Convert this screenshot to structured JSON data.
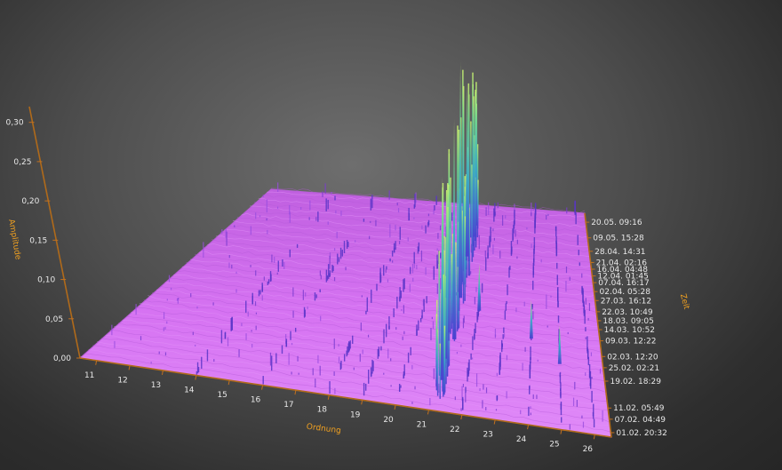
{
  "chart_data": {
    "type": "surface-3d",
    "title": "",
    "axes": {
      "amplitude": {
        "label": "Amplitude",
        "ticks": [
          "0,00",
          "0,05",
          "0,10",
          "0,15",
          "0,20",
          "0,25",
          "0,30"
        ],
        "range": [
          0,
          0.3
        ]
      },
      "ordnung": {
        "label": "Ordnung",
        "ticks": [
          "11",
          "12",
          "13",
          "14",
          "15",
          "16",
          "17",
          "18",
          "19",
          "20",
          "21",
          "22",
          "23",
          "24",
          "25",
          "26"
        ],
        "range": [
          10.5,
          26.5
        ]
      },
      "zeit": {
        "label": "Zeit",
        "ticks": [
          "20.05. 09:16",
          "09.05. 15:28",
          "28.04. 14:31",
          "21.04. 02:16",
          "16.04. 04:48",
          "12.04. 01:45",
          "07.04. 16:17",
          "02.04. 05:28",
          "27.03. 16:12",
          "22.03. 10:49",
          "18.03. 09:05",
          "14.03. 10:52",
          "09.03. 12:22",
          "02.03. 12:20",
          "25.02. 02:21",
          "19.02. 18:29",
          "11.02. 05:49",
          "07.02. 04:49",
          "01.02. 20:32"
        ]
      }
    },
    "peaks": [
      {
        "ordnung": 21.2,
        "zeit_frac": 0.55,
        "amplitude": 0.3
      },
      {
        "ordnung": 21.3,
        "zeit_frac": 0.35,
        "amplitude": 0.28
      },
      {
        "ordnung": 21.1,
        "zeit_frac": 0.75,
        "amplitude": 0.22
      },
      {
        "ordnung": 21.2,
        "zeit_frac": 0.15,
        "amplitude": 0.26
      },
      {
        "ordnung": 22.0,
        "zeit_frac": 0.5,
        "amplitude": 0.06
      },
      {
        "ordnung": 24.0,
        "zeit_frac": 0.4,
        "amplitude": 0.05
      },
      {
        "ordnung": 25.0,
        "zeit_frac": 0.3,
        "amplitude": 0.05
      }
    ],
    "colors": {
      "surface": "#d66ef0",
      "surface_dark": "#8a3fc8",
      "peak_low": "#4a3fd0",
      "peak_mid": "#3aa8c8",
      "peak_high": "#a8f060",
      "axis": "#b06a1a",
      "axis_title": "#f0a020",
      "tick_label": "#e8e8e8"
    }
  }
}
